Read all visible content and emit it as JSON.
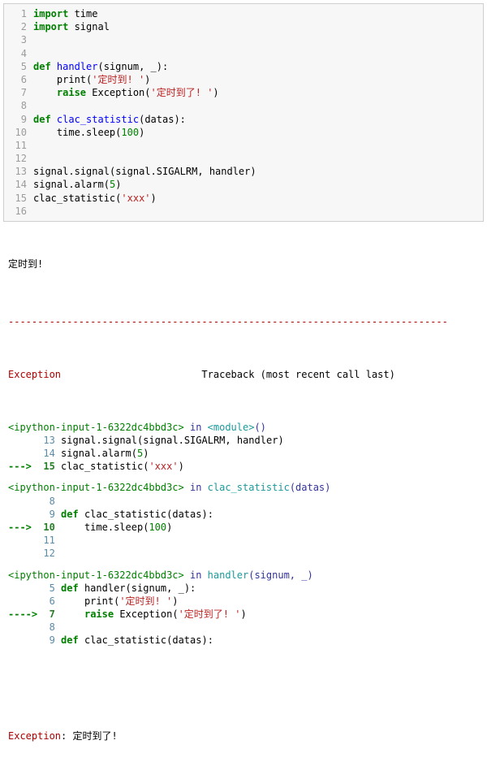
{
  "code": {
    "language": "python",
    "lines": {
      "1": {
        "tokens": [
          [
            "kw",
            "import"
          ],
          [
            "nm",
            " time"
          ]
        ]
      },
      "2": {
        "tokens": [
          [
            "kw",
            "import"
          ],
          [
            "nm",
            " signal"
          ]
        ]
      },
      "3": {
        "tokens": []
      },
      "4": {
        "tokens": []
      },
      "5": {
        "tokens": [
          [
            "kw",
            "def"
          ],
          [
            "nm",
            " "
          ],
          [
            "fn",
            "handler"
          ],
          [
            "pn",
            "("
          ],
          [
            "arg",
            "signum"
          ],
          [
            "pn",
            ", "
          ],
          [
            "arg",
            "_"
          ],
          [
            "pn",
            "):"
          ]
        ]
      },
      "6": {
        "tokens": [
          [
            "nm",
            "    "
          ],
          [
            "nm",
            "print"
          ],
          [
            "pn",
            "("
          ],
          [
            "str",
            "'定时到! '"
          ],
          [
            "pn",
            ")"
          ]
        ]
      },
      "7": {
        "tokens": [
          [
            "nm",
            "    "
          ],
          [
            "kw",
            "raise"
          ],
          [
            "nm",
            " Exception"
          ],
          [
            "pn",
            "("
          ],
          [
            "str",
            "'定时到了! '"
          ],
          [
            "pn",
            ")"
          ]
        ]
      },
      "8": {
        "tokens": []
      },
      "9": {
        "tokens": [
          [
            "kw",
            "def"
          ],
          [
            "nm",
            " "
          ],
          [
            "fn",
            "clac_statistic"
          ],
          [
            "pn",
            "("
          ],
          [
            "arg",
            "datas"
          ],
          [
            "pn",
            "):"
          ]
        ]
      },
      "10": {
        "tokens": [
          [
            "nm",
            "    time"
          ],
          [
            "pn",
            "."
          ],
          [
            "nm",
            "sleep"
          ],
          [
            "pn",
            "("
          ],
          [
            "num",
            "100"
          ],
          [
            "pn",
            ")"
          ]
        ]
      },
      "11": {
        "tokens": []
      },
      "12": {
        "tokens": []
      },
      "13": {
        "tokens": [
          [
            "nm",
            "signal"
          ],
          [
            "pn",
            "."
          ],
          [
            "nm",
            "signal"
          ],
          [
            "pn",
            "("
          ],
          [
            "nm",
            "signal"
          ],
          [
            "pn",
            "."
          ],
          [
            "nm",
            "SIGALRM"
          ],
          [
            "pn",
            ", "
          ],
          [
            "nm",
            "handler"
          ],
          [
            "pn",
            ")"
          ]
        ]
      },
      "14": {
        "tokens": [
          [
            "nm",
            "signal"
          ],
          [
            "pn",
            "."
          ],
          [
            "nm",
            "alarm"
          ],
          [
            "pn",
            "("
          ],
          [
            "num",
            "5"
          ],
          [
            "pn",
            ")"
          ]
        ]
      },
      "15": {
        "tokens": [
          [
            "nm",
            "clac_statistic"
          ],
          [
            "pn",
            "("
          ],
          [
            "str",
            "'xxx'"
          ],
          [
            "pn",
            ")"
          ]
        ]
      },
      "16": {
        "tokens": []
      }
    },
    "line_numbers": [
      "1",
      "2",
      "3",
      "4",
      "5",
      "6",
      "7",
      "8",
      "9",
      "10",
      "11",
      "12",
      "13",
      "14",
      "15",
      "16"
    ]
  },
  "output": {
    "stdout": "定时到! ",
    "dash_line": "---------------------------------------------------------------------------",
    "exception_header": {
      "name": "Exception",
      "right": "Traceback (most recent call last)"
    },
    "frames": [
      {
        "loc_pre": "<ipython-input-1-6322dc4bbd3c>",
        "loc_in": " in ",
        "loc_fn": "<module>",
        "loc_args": "()",
        "lines": [
          {
            "arrow": false,
            "no": "13",
            "code_tokens": [
              [
                "nm",
                "signal"
              ],
              [
                "pn",
                "."
              ],
              [
                "nm",
                "signal"
              ],
              [
                "pn",
                "("
              ],
              [
                "nm",
                "signal"
              ],
              [
                "pn",
                "."
              ],
              [
                "nm",
                "SIGALRM"
              ],
              [
                "pn",
                ", "
              ],
              [
                "nm",
                "handler"
              ],
              [
                "pn",
                ")"
              ]
            ]
          },
          {
            "arrow": false,
            "no": "14",
            "code_tokens": [
              [
                "nm",
                "signal"
              ],
              [
                "pn",
                "."
              ],
              [
                "nm",
                "alarm"
              ],
              [
                "pn",
                "("
              ],
              [
                "py-num",
                "5"
              ],
              [
                "pn",
                ")"
              ]
            ]
          },
          {
            "arrow": true,
            "no": "15",
            "code_tokens": [
              [
                "nm",
                "clac_statistic"
              ],
              [
                "pn",
                "("
              ],
              [
                "py-str",
                "'xxx'"
              ],
              [
                "pn",
                ")"
              ]
            ]
          }
        ]
      },
      {
        "loc_pre": "<ipython-input-1-6322dc4bbd3c>",
        "loc_in": " in ",
        "loc_fn": "clac_statistic",
        "loc_args": "(datas)",
        "lines": [
          {
            "arrow": false,
            "no": "8",
            "code_tokens": []
          },
          {
            "arrow": false,
            "no": "9",
            "code_tokens": [
              [
                "py-kw",
                "def"
              ],
              [
                "nm",
                " clac_statistic"
              ],
              [
                "pn",
                "("
              ],
              [
                "nm",
                "datas"
              ],
              [
                "pn",
                "):"
              ]
            ]
          },
          {
            "arrow": true,
            "no": "10",
            "code_tokens": [
              [
                "nm",
                "    time"
              ],
              [
                "pn",
                "."
              ],
              [
                "nm",
                "sleep"
              ],
              [
                "pn",
                "("
              ],
              [
                "py-num",
                "100"
              ],
              [
                "pn",
                ")"
              ]
            ]
          },
          {
            "arrow": false,
            "no": "11",
            "code_tokens": []
          },
          {
            "arrow": false,
            "no": "12",
            "code_tokens": []
          }
        ]
      },
      {
        "loc_pre": "<ipython-input-1-6322dc4bbd3c>",
        "loc_in": " in ",
        "loc_fn": "handler",
        "loc_args": "(signum, _)",
        "lines": [
          {
            "arrow": false,
            "no": "5",
            "code_tokens": [
              [
                "py-kw",
                "def"
              ],
              [
                "nm",
                " handler"
              ],
              [
                "pn",
                "("
              ],
              [
                "nm",
                "signum"
              ],
              [
                "pn",
                ", "
              ],
              [
                "nm",
                "_"
              ],
              [
                "pn",
                "):"
              ]
            ]
          },
          {
            "arrow": false,
            "no": "6",
            "code_tokens": [
              [
                "nm",
                "    print"
              ],
              [
                "pn",
                "("
              ],
              [
                "py-str",
                "'定时到! '"
              ],
              [
                "pn",
                ")"
              ]
            ]
          },
          {
            "arrow": true,
            "arrow4": true,
            "no": "7",
            "code_tokens": [
              [
                "nm",
                "    "
              ],
              [
                "py-kw",
                "raise"
              ],
              [
                "nm",
                " Exception"
              ],
              [
                "pn",
                "("
              ],
              [
                "py-str",
                "'定时到了! '"
              ],
              [
                "pn",
                ")"
              ]
            ]
          },
          {
            "arrow": false,
            "no": "8",
            "code_tokens": []
          },
          {
            "arrow": false,
            "no": "9",
            "code_tokens": [
              [
                "py-kw",
                "def"
              ],
              [
                "nm",
                " clac_statistic"
              ],
              [
                "pn",
                "("
              ],
              [
                "nm",
                "datas"
              ],
              [
                "pn",
                "):"
              ]
            ]
          }
        ]
      }
    ],
    "final": {
      "name": "Exception",
      "sep": ": ",
      "message": "定时到了! "
    }
  }
}
